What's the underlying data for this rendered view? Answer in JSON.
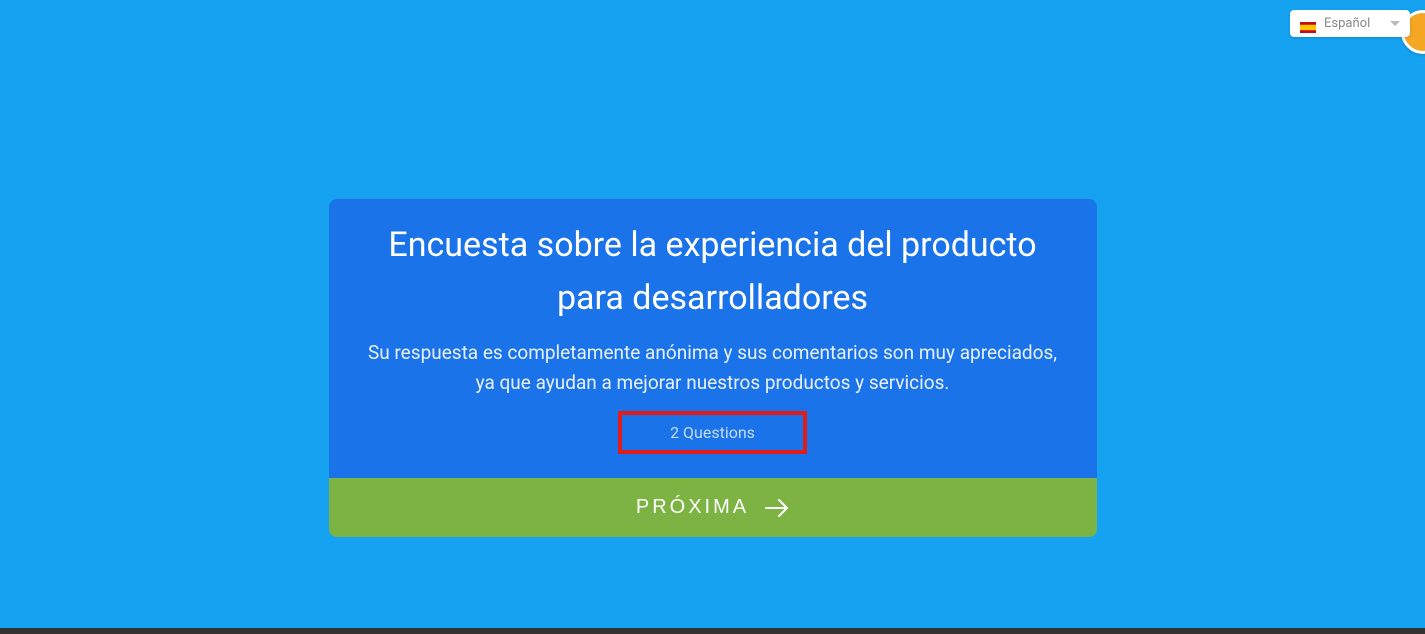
{
  "language_selector": {
    "label": "Español"
  },
  "survey": {
    "title": "Encuesta sobre la experiencia del producto para desarrolladores",
    "description": "Su respuesta es completamente anónima y sus comentarios son muy apreciados, ya que ayudan a mejorar nuestros productos y servicios.",
    "questions_label": "2 Questions"
  },
  "next_button": {
    "label": "PRÓXIMA"
  }
}
